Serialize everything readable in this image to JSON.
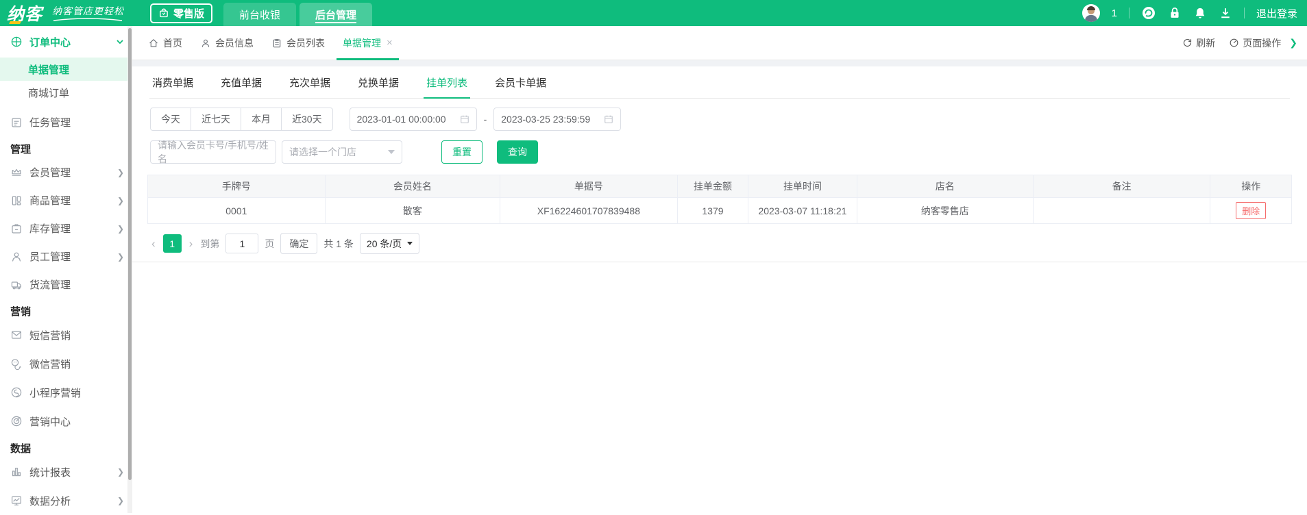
{
  "topbar": {
    "logo": "纳客",
    "tagline": "纳客管店更轻松",
    "badge": "零售版",
    "nav": {
      "cashier": "前台收银",
      "backend": "后台管理"
    },
    "user_count": "1",
    "logout": "退出登录"
  },
  "sidebar": {
    "items": [
      "订单中心",
      "单据管理",
      "商城订单",
      "任务管理",
      "管理",
      "会员管理",
      "商品管理",
      "库存管理",
      "员工管理",
      "货流管理",
      "营销",
      "短信营销",
      "微信营销",
      "小程序营销",
      "营销中心",
      "数据",
      "统计报表",
      "数据分析"
    ]
  },
  "crumbs": {
    "tabs": [
      "首页",
      "会员信息",
      "会员列表",
      "单据管理"
    ],
    "close": "×",
    "refresh": "刷新",
    "page_ops": "页面操作"
  },
  "doc_tabs": [
    "消费单据",
    "充值单据",
    "充次单据",
    "兑换单据",
    "挂单列表",
    "会员卡单据"
  ],
  "filters": {
    "quick": [
      "今天",
      "近七天",
      "本月",
      "近30天"
    ],
    "date_from": "2023-01-01 00:00:00",
    "date_sep": "-",
    "date_to": "2023-03-25 23:59:59",
    "member_placeholder": "请输入会员卡号/手机号/姓名",
    "store_placeholder": "请选择一个门店",
    "reset": "重置",
    "search": "查询"
  },
  "table": {
    "columns": [
      "手牌号",
      "会员姓名",
      "单据号",
      "挂单金额",
      "挂单时间",
      "店名",
      "备注",
      "操作"
    ],
    "rows": [
      {
        "hand_no": "0001",
        "member_name": "散客",
        "order_no": "XF16224601707839488",
        "amount": "1379",
        "time": "2023-03-07 11:18:21",
        "store": "纳客零售店",
        "remark": "",
        "action": "删除"
      }
    ]
  },
  "pagination": {
    "prev": "‹",
    "page": "1",
    "next": "›",
    "goto_prefix": "到第",
    "goto_value": "1",
    "goto_suffix": "页",
    "confirm": "确定",
    "total": "共 1 条",
    "size": "20 条/页"
  },
  "colors": {
    "primary": "#0FBC7D",
    "danger": "#F56C6C"
  }
}
